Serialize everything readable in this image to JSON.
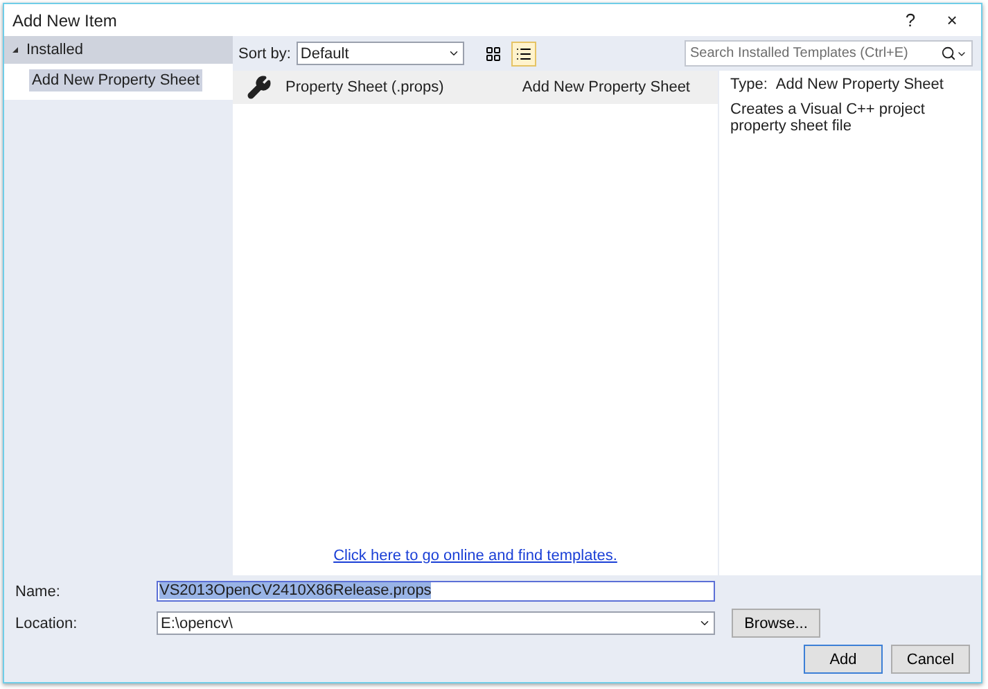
{
  "window": {
    "title": "Add New Item",
    "help": "?",
    "close": "×"
  },
  "sidebar": {
    "items": [
      {
        "label": "Installed",
        "expanded": true,
        "children": [
          {
            "label": "Add New Property Sheet",
            "selected": true
          }
        ]
      }
    ]
  },
  "toolbar": {
    "sort_label": "Sort by:",
    "sort_value": "Default",
    "views": [
      {
        "kind": "grid",
        "selected": false
      },
      {
        "kind": "list",
        "selected": true
      }
    ],
    "search": {
      "placeholder": "Search Installed Templates (Ctrl+E)"
    }
  },
  "templates": [
    {
      "name": "Property Sheet (.props)",
      "category": "Add New Property Sheet",
      "selected": true
    }
  ],
  "online_link": "Click here to go online and find templates.",
  "details": {
    "type_label": "Type:",
    "type_value": "Add New Property Sheet",
    "description": "Creates a Visual C++ project property sheet file"
  },
  "form": {
    "name_label": "Name:",
    "name_value": "VS2013OpenCV2410X86Release.props",
    "location_label": "Location:",
    "location_value": "E:\\opencv\\",
    "browse": "Browse..."
  },
  "buttons": [
    {
      "label": "Add",
      "default": true
    },
    {
      "label": "Cancel",
      "default": false
    }
  ]
}
